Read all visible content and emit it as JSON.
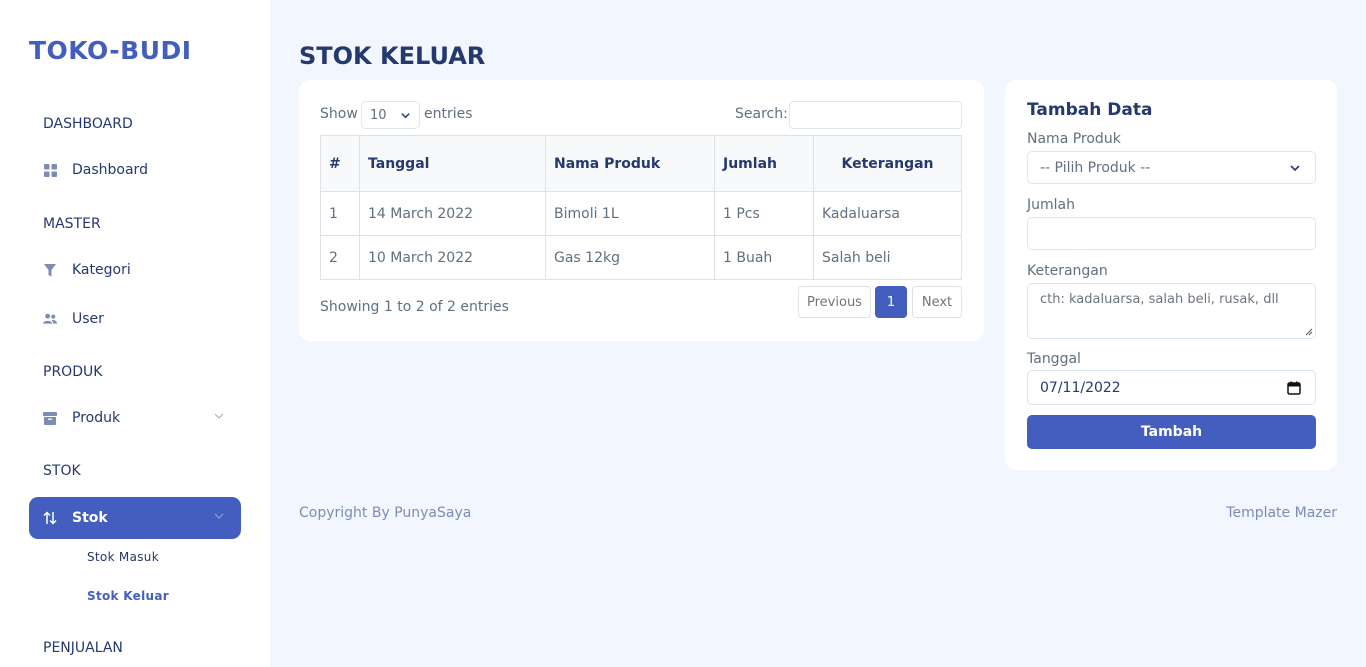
{
  "brand": "TOKO-BUDI",
  "sidebar": {
    "sections": [
      {
        "title": "DASHBOARD"
      },
      {
        "title": "MASTER"
      },
      {
        "title": "PRODUK"
      },
      {
        "title": "STOK"
      },
      {
        "title": "PENJUALAN"
      }
    ],
    "items": [
      {
        "label": "Dashboard",
        "icon": "grid-icon"
      },
      {
        "label": "Kategori",
        "icon": "filter-icon"
      },
      {
        "label": "User",
        "icon": "people-icon"
      },
      {
        "label": "Produk",
        "icon": "archive-icon"
      },
      {
        "label": "Stok",
        "icon": "arrow-up-down-icon"
      }
    ],
    "submenu": [
      {
        "label": "Stok Masuk"
      },
      {
        "label": "Stok Keluar"
      }
    ]
  },
  "page": {
    "title": "STOK KELUAR"
  },
  "table_card": {
    "show_label": "Show",
    "entries_value": "10",
    "entries_label": "entries",
    "search_label": "Search:",
    "search_value": "",
    "headers": [
      "#",
      "Tanggal",
      "Nama Produk",
      "Jumlah",
      "Keterangan"
    ],
    "rows": [
      [
        "1",
        "14 March 2022",
        "Bimoli 1L",
        "1 Pcs",
        "Kadaluarsa"
      ],
      [
        "2",
        "10 March 2022",
        "Gas 12kg",
        "1 Buah",
        "Salah beli"
      ]
    ],
    "info": "Showing 1 to 2 of 2 entries",
    "pager": {
      "previous": "Previous",
      "current": "1",
      "next": "Next"
    }
  },
  "form": {
    "title": "Tambah Data",
    "nama_label": "Nama Produk",
    "nama_value": "-- Pilih Produk --",
    "jumlah_label": "Jumlah",
    "jumlah_value": "",
    "keterangan_label": "Keterangan",
    "keterangan_placeholder": "cth: kadaluarsa, salah beli, rusak, dll",
    "tanggal_label": "Tanggal",
    "tanggal_value": "07/11/2022",
    "submit": "Tambah"
  },
  "footer": {
    "left": "Copyright By PunyaSaya",
    "right": "Template Mazer"
  },
  "colors": {
    "primary": "#435ebe",
    "heading": "#25396f",
    "body": "#607080",
    "background": "#f2f7ff"
  }
}
